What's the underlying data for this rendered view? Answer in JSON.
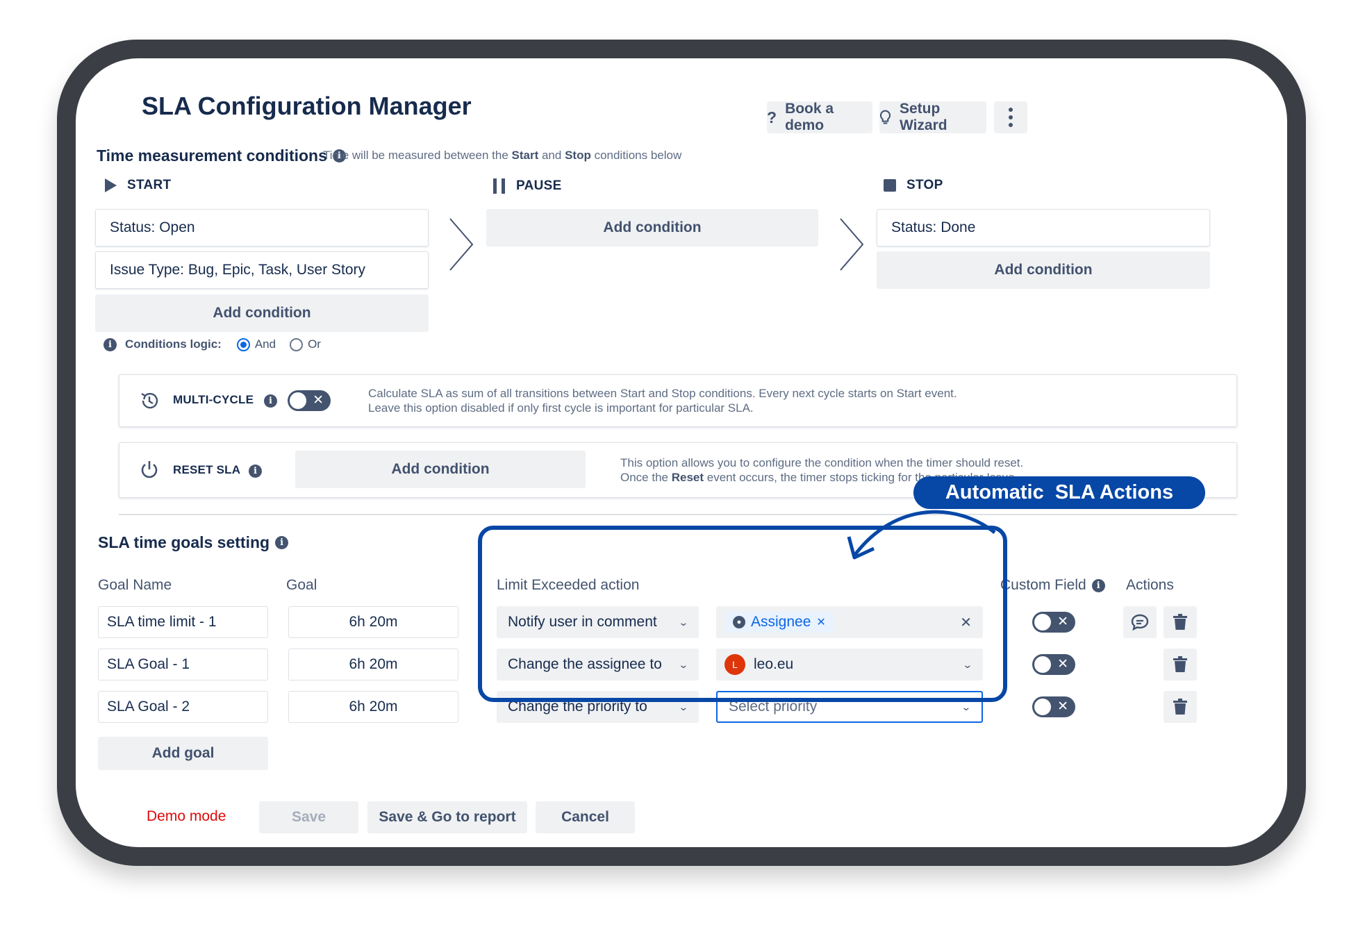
{
  "header": {
    "title": "SLA Configuration Manager",
    "book_demo": "Book a demo",
    "setup_wizard": "Setup Wizard"
  },
  "time_conditions": {
    "title": "Time measurement conditions",
    "hint_prefix": "Time will be measured between the ",
    "hint_start": "Start",
    "hint_and": " and ",
    "hint_stop": "Stop",
    "hint_suffix": " conditions below",
    "start": {
      "label": "START",
      "conditions": [
        "Status: Open",
        "Issue Type: Bug, Epic, Task, User Story"
      ],
      "add": "Add condition"
    },
    "pause": {
      "label": "PAUSE",
      "add": "Add condition"
    },
    "stop": {
      "label": "STOP",
      "conditions": [
        "Status: Done"
      ],
      "add": "Add condition"
    },
    "logic": {
      "label": "Conditions logic:",
      "and": "And",
      "or": "Or",
      "selected": "And"
    }
  },
  "multicycle": {
    "label": "MULTI-CYCLE",
    "enabled": false,
    "desc_line1": "Calculate SLA as sum of all transitions between Start and Stop conditions. Every next cycle starts on Start event.",
    "desc_line2": "Leave this option disabled if only first cycle is important for particular SLA."
  },
  "reset": {
    "label": "RESET SLA",
    "add": "Add condition",
    "desc_line1": "This option allows you to configure the condition when the timer should reset.",
    "desc_line2_prefix": "Once the ",
    "desc_line2_bold": "Reset",
    "desc_line2_suffix": " event occurs, the timer stops ticking for the particular Issue."
  },
  "goals": {
    "title": "SLA time goals setting",
    "columns": {
      "name": "Goal Name",
      "goal": "Goal",
      "action": "Limit Exceeded action",
      "custom_field": "Custom Field",
      "actions": "Actions"
    },
    "rows": [
      {
        "name": "SLA time limit - 1",
        "goal": "6h 20m",
        "action": "Notify user in comment",
        "target": "Assignee",
        "custom_field": false
      },
      {
        "name": "SLA Goal - 1",
        "goal": "6h 20m",
        "action": "Change the assignee to",
        "target": "leo.eu",
        "avatar_letter": "L",
        "custom_field": false
      },
      {
        "name": "SLA Goal - 2",
        "goal": "6h 20m",
        "action": "Change the priority to",
        "target_placeholder": "Select priority",
        "custom_field": false
      }
    ],
    "add_goal": "Add goal"
  },
  "callout": {
    "label": "Automatic  SLA Actions"
  },
  "footer": {
    "demo_mode": "Demo mode",
    "save": "Save",
    "save_report": "Save & Go to report",
    "cancel": "Cancel"
  },
  "colors": {
    "primary_text": "#172b4d",
    "accent_blue": "#0747a6",
    "link_blue": "#0c66e4",
    "demo_red": "#de0a0a",
    "button_bg": "#f0f1f3"
  }
}
